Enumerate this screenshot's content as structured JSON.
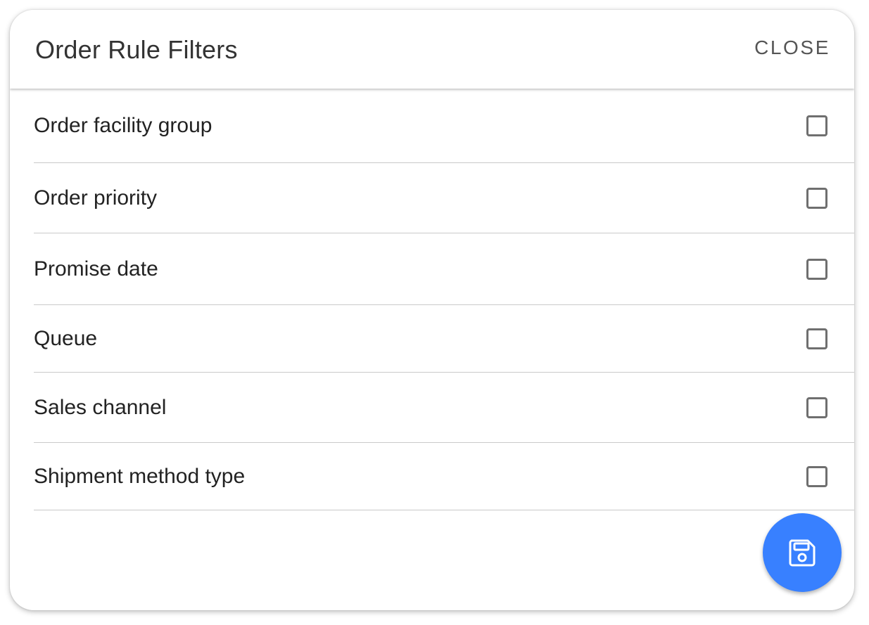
{
  "modal": {
    "title": "Order Rule Filters",
    "close_label": "CLOSE"
  },
  "filters": [
    {
      "label": "Order facility group",
      "checked": false
    },
    {
      "label": "Order priority",
      "checked": false
    },
    {
      "label": "Promise date",
      "checked": false
    },
    {
      "label": "Queue",
      "checked": false
    },
    {
      "label": "Sales channel",
      "checked": false
    },
    {
      "label": "Shipment method type",
      "checked": false
    }
  ],
  "fab": {
    "icon": "save-icon",
    "color": "#3880ff"
  },
  "colors": {
    "title_text": "#333333",
    "divider": "#c9c9c9",
    "checkbox_border": "#6f6f6f"
  }
}
